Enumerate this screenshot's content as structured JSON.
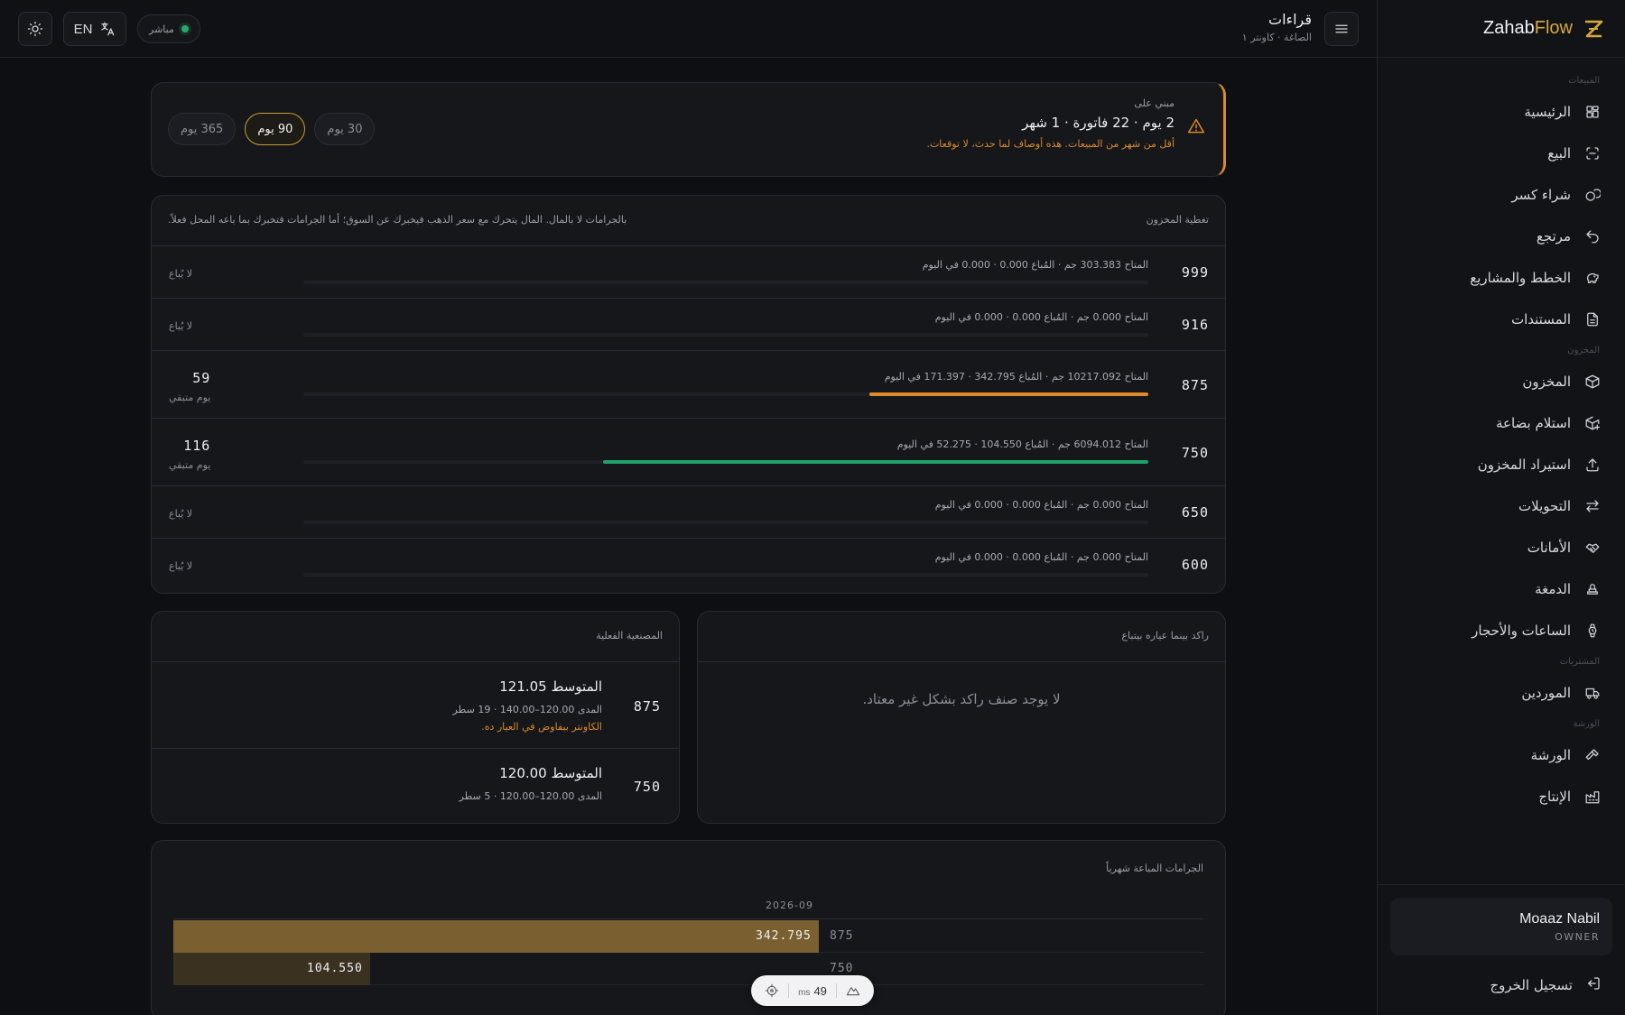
{
  "brand": {
    "name_a": "Zahab",
    "name_b": "Flow"
  },
  "sidebar": {
    "sections": [
      {
        "label": "المبيعات",
        "items": [
          {
            "label": "الرئيسية",
            "icon": "dashboard-icon"
          },
          {
            "label": "البيع",
            "icon": "scan-icon"
          },
          {
            "label": "شراء كسر",
            "icon": "coins-icon"
          },
          {
            "label": "مرتجع",
            "icon": "undo-icon"
          },
          {
            "label": "الخطط والمشاريع",
            "icon": "piggy-bank-icon"
          },
          {
            "label": "المستندات",
            "icon": "document-icon"
          }
        ]
      },
      {
        "label": "المخزون",
        "items": [
          {
            "label": "المخزون",
            "icon": "box-icon"
          },
          {
            "label": "استلام بضاعة",
            "icon": "box-plus-icon"
          },
          {
            "label": "استيراد المخزون",
            "icon": "upload-icon"
          },
          {
            "label": "التحويلات",
            "icon": "transfer-icon"
          },
          {
            "label": "الأمانات",
            "icon": "handshake-icon"
          },
          {
            "label": "الدمغة",
            "icon": "stamp-icon"
          },
          {
            "label": "الساعات والأحجار",
            "icon": "watch-icon"
          }
        ]
      },
      {
        "label": "المشتريات",
        "items": [
          {
            "label": "الموردين",
            "icon": "truck-icon"
          }
        ]
      },
      {
        "label": "الورشة",
        "items": [
          {
            "label": "الورشة",
            "icon": "hammer-icon"
          },
          {
            "label": "الإنتاج",
            "icon": "factory-icon"
          }
        ]
      }
    ],
    "user": {
      "name": "Moaaz Nabil",
      "role": "OWNER"
    },
    "logout": "تسجيل الخروج"
  },
  "topbar": {
    "title": "قراءات",
    "subtitle": "الصاغة · كاونتر ١",
    "lang": "EN",
    "live": "مباشر"
  },
  "alert": {
    "kicker": "مبني على",
    "headline": "2 يوم · 22 فاتورة · 1 شهر",
    "note": "أقل من شهر من المبيعات. هذه أوصاف لما حدث، لا توقعات.",
    "ranges": [
      {
        "label": "30 يوم",
        "active": false
      },
      {
        "label": "90 يوم",
        "active": true
      },
      {
        "label": "365 يوم",
        "active": false
      }
    ]
  },
  "coverage": {
    "title": "تغطية المخزون",
    "note": "بالجرامات لا بالمال. المال يتحرك مع سعر الذهب فيخبرك عن السوق؛ أما الجرامات فتخبرك بما باعه المحل فعلاً.",
    "rows": [
      {
        "karat": "999",
        "desc": "المتاح 303.383 جم · المُباع 0.000 · 0.000 في اليوم",
        "status": "لا يُباع",
        "days": null,
        "fill": 0,
        "color": ""
      },
      {
        "karat": "916",
        "desc": "المتاح 0.000 جم · المُباع 0.000 · 0.000 في اليوم",
        "status": "لا يُباع",
        "days": null,
        "fill": 0,
        "color": ""
      },
      {
        "karat": "875",
        "desc": "المتاح 10217.092 جم · المُباع 342.795 · 171.397 في اليوم",
        "status": "",
        "days": "59",
        "days_unit": "يوم متبقي",
        "fill": 0.33,
        "color": "#e08a2c"
      },
      {
        "karat": "750",
        "desc": "المتاح 6094.012 جم · المُباع 104.550 · 52.275 في اليوم",
        "status": "",
        "days": "116",
        "days_unit": "يوم متبقي",
        "fill": 0.645,
        "color": "#21a16a"
      },
      {
        "karat": "650",
        "desc": "المتاح 0.000 جم · المُباع 0.000 · 0.000 في اليوم",
        "status": "لا يُباع",
        "days": null,
        "fill": 0,
        "color": ""
      },
      {
        "karat": "600",
        "desc": "المتاح 0.000 جم · المُباع 0.000 · 0.000 في اليوم",
        "status": "لا يُباع",
        "days": null,
        "fill": 0,
        "color": ""
      }
    ]
  },
  "stagnant": {
    "title": "راكد بينما عياره بيتباع",
    "empty": "لا يوجد صنف راكد بشكل غير معتاد."
  },
  "making": {
    "title": "المصنعية الفعلية",
    "rows": [
      {
        "karat": "875",
        "avg": "المتوسط 121.05",
        "range": "المدى 120.00–140.00 · 19 سطر",
        "warn": "الكاونتر بيفاوض في العيار ده."
      },
      {
        "karat": "750",
        "avg": "المتوسط 120.00",
        "range": "المدى 120.00–120.00 · 5 سطر",
        "warn": ""
      }
    ]
  },
  "monthly": {
    "title": "الجرامات المباعة شهرياً",
    "month": "2026-09",
    "rows": [
      {
        "karat": "875",
        "value": 342.795,
        "label": "342.795",
        "color": "#7a6030"
      },
      {
        "karat": "750",
        "value": 104.55,
        "label": "104.550",
        "color": "#3a3120"
      }
    ],
    "max": 342.795
  },
  "perf": {
    "ms": "49",
    "unit": "ms"
  }
}
